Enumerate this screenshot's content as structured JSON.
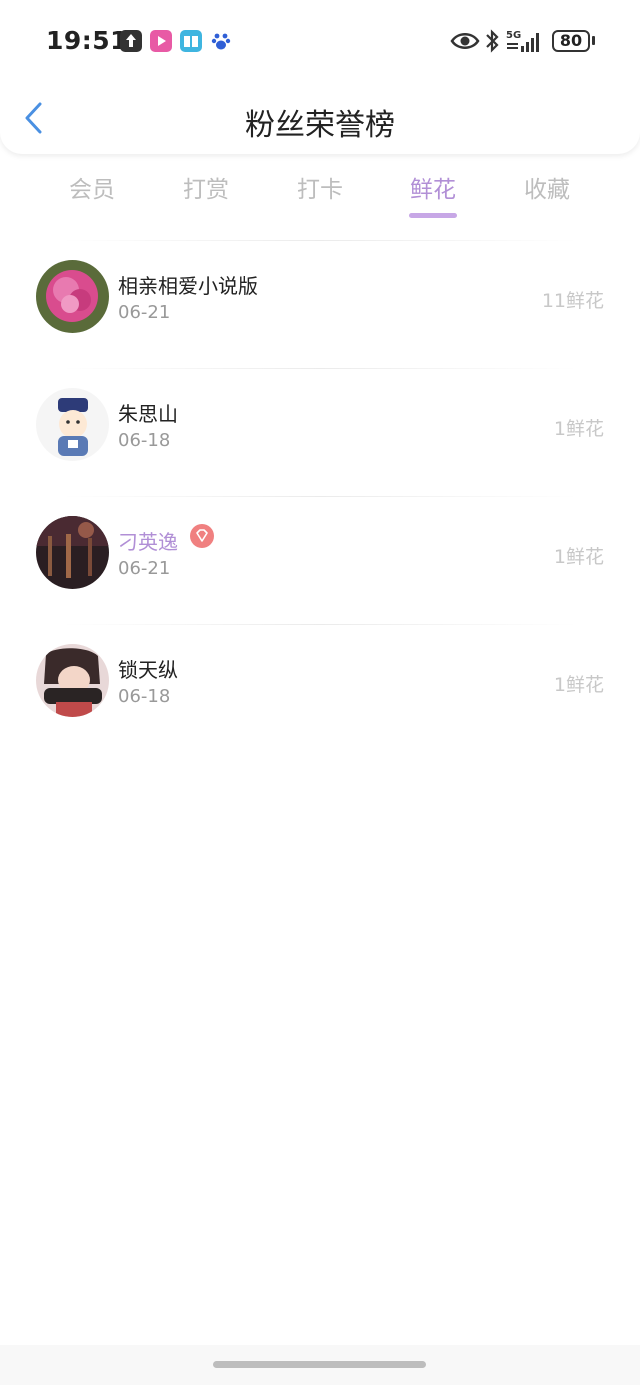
{
  "status_bar": {
    "time": "19:51",
    "battery": "80",
    "network": "5G"
  },
  "header": {
    "title": "粉丝荣誉榜"
  },
  "tabs": [
    {
      "label": "会员",
      "active": false
    },
    {
      "label": "打赏",
      "active": false
    },
    {
      "label": "打卡",
      "active": false
    },
    {
      "label": "鲜花",
      "active": true
    },
    {
      "label": "收藏",
      "active": false
    }
  ],
  "colors": {
    "accent": "#b18fd6",
    "indicator": "#c7a7e6",
    "muted": "#c8c8c8",
    "back": "#4a90e2"
  },
  "list": [
    {
      "name": "相亲相爱小说版",
      "date": "06-21",
      "amount": "11鲜花",
      "vip": false
    },
    {
      "name": "朱思山",
      "date": "06-18",
      "amount": "1鲜花",
      "vip": false
    },
    {
      "name": "刁英逸",
      "date": "06-21",
      "amount": "1鲜花",
      "vip": true
    },
    {
      "name": "锁天纵",
      "date": "06-18",
      "amount": "1鲜花",
      "vip": false
    }
  ]
}
